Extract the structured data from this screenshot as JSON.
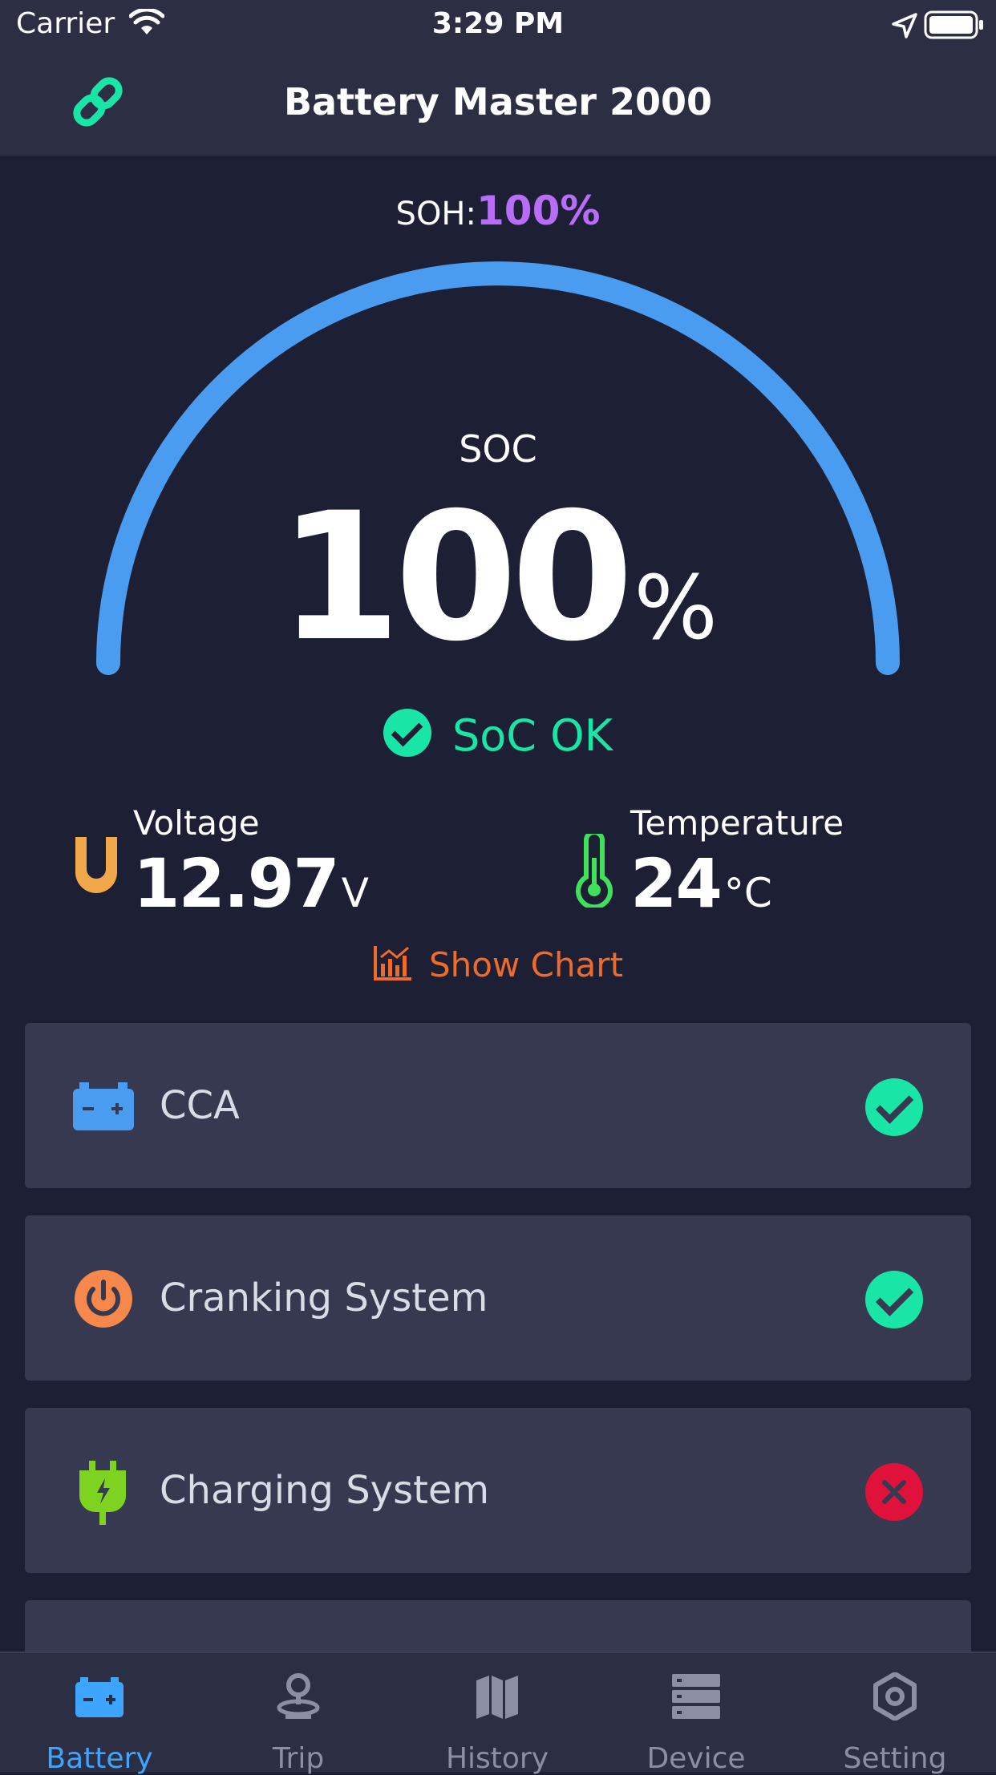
{
  "status_bar": {
    "carrier": "Carrier",
    "time": "3:29 PM"
  },
  "header": {
    "title": "Battery Master 2000",
    "link_icon": "link-icon"
  },
  "gauge": {
    "soh_label": "SOH:",
    "soh_value": "100%",
    "soc_label": "SOC",
    "soc_value": "100",
    "soc_unit": "%",
    "soc_level": 1.0,
    "status": "SoC OK",
    "arc_color": "#4a9cf0"
  },
  "metrics": {
    "voltage": {
      "label": "Voltage",
      "value": "12.97",
      "unit": "V",
      "icon": "magnet-icon"
    },
    "temperature": {
      "label": "Temperature",
      "value": "24",
      "unit": "°C",
      "icon": "thermometer-icon"
    }
  },
  "show_chart": {
    "label": "Show Chart",
    "icon": "chart-icon"
  },
  "checks": [
    {
      "label": "CCA",
      "status": "ok",
      "icon": "battery-icon"
    },
    {
      "label": "Cranking System",
      "status": "ok",
      "icon": "power-icon"
    },
    {
      "label": "Charging System",
      "status": "fail",
      "icon": "plug-icon"
    }
  ],
  "tabs": [
    {
      "label": "Battery",
      "icon": "battery-icon",
      "active": true
    },
    {
      "label": "Trip",
      "icon": "location-pin-icon",
      "active": false
    },
    {
      "label": "History",
      "icon": "map-icon",
      "active": false
    },
    {
      "label": "Device",
      "icon": "server-icon",
      "active": false
    },
    {
      "label": "Setting",
      "icon": "gear-hex-icon",
      "active": false
    }
  ],
  "colors": {
    "background": "#1d2035",
    "card": "#363950",
    "ok": "#19e6a6",
    "fail": "#e0123c",
    "accent_blue": "#3da5ff",
    "soh_purple": "#b86df6",
    "chart_orange": "#f06b2a"
  }
}
